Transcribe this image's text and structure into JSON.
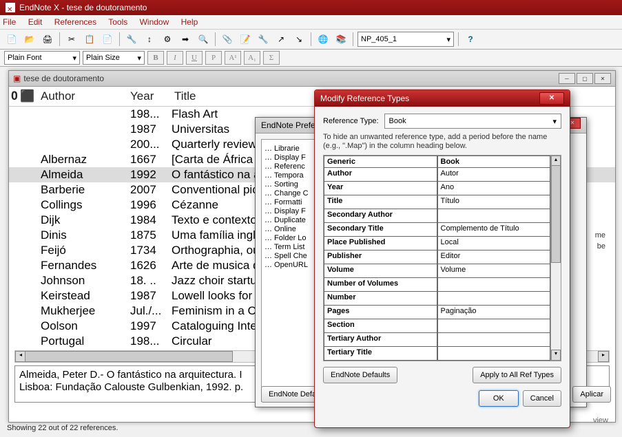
{
  "app_title": "EndNote X - tese de doutoramento",
  "menus": [
    "File",
    "Edit",
    "References",
    "Tools",
    "Window",
    "Help"
  ],
  "style_dropdown": "NP_405_1",
  "font_name": "Plain Font",
  "font_size": "Plain Size",
  "lib_title": "tese de doutoramento",
  "columns": {
    "author": "Author",
    "year": "Year",
    "title": "Title"
  },
  "rows": [
    {
      "author": "",
      "year": "198...",
      "title": "Flash Art"
    },
    {
      "author": "",
      "year": "1987",
      "title": "Universitas"
    },
    {
      "author": "",
      "year": "200...",
      "title": "Quarterly review of"
    },
    {
      "author": "Albernaz",
      "year": "1667",
      "title": "[Carta de África O"
    },
    {
      "author": "Almeida",
      "year": "1992",
      "title": "O fantástico na arq",
      "sel": true
    },
    {
      "author": "Barberie",
      "year": "2007",
      "title": "Conventional pictu"
    },
    {
      "author": "Collings",
      "year": "1996",
      "title": "Cézanne"
    },
    {
      "author": "Dijk",
      "year": "1984",
      "title": "Texto e contexto"
    },
    {
      "author": "Dinis",
      "year": "1875",
      "title": "Uma família inglez"
    },
    {
      "author": "Feijó",
      "year": "1734",
      "title": "Orthographia, ou a"
    },
    {
      "author": "Fernandes",
      "year": "1626",
      "title": "Arte de musica de"
    },
    {
      "author": "Johnson",
      "year": "18. ..",
      "title": "Jazz choir startup"
    },
    {
      "author": "Keirstead",
      "year": "1987",
      "title": "Lowell looks for an"
    },
    {
      "author": "Mukherjee",
      "year": "Jul./...",
      "title": "Feminism in a Cal"
    },
    {
      "author": "Oolson",
      "year": "1997",
      "title": "Cataloguing Intern"
    },
    {
      "author": "Portugal",
      "year": "198...",
      "title": "Circular"
    }
  ],
  "preview_line1": "Almeida, Peter D.- O fantástico na arquitectura.  I",
  "preview_line2": "Lisboa: Fundação Calouste Gulbenkian, 1992. p.",
  "status": "Showing 22 out of 22 references.",
  "pref_title": "EndNote Prefer",
  "pref_tree": [
    "Librarie",
    "Display F",
    "Referenc",
    "Tempora",
    "Sorting",
    "Change C",
    "Formatti",
    "Display F",
    "Duplicate",
    "Online",
    "Folder Lo",
    "Term List",
    "Spell Che",
    "OpenURL"
  ],
  "pref_defaults": "EndNote Defa",
  "pref_aplicar": "Aplicar",
  "modify_title": "Modify Reference Types",
  "rt_label": "Reference Type:",
  "rt_value": "Book",
  "hint": "To hide an unwanted reference type, add a period before the name (e.g., \".Map\") in the column heading below.",
  "map_header": {
    "left": "Generic",
    "right": "Book"
  },
  "map_rows": [
    {
      "g": "Author",
      "b": "Autor"
    },
    {
      "g": "Year",
      "b": "Ano"
    },
    {
      "g": "Title",
      "b": "Título"
    },
    {
      "g": "Secondary Author",
      "b": ""
    },
    {
      "g": "Secondary Title",
      "b": "Complemento de Título"
    },
    {
      "g": "Place Published",
      "b": "Local"
    },
    {
      "g": "Publisher",
      "b": "Editor"
    },
    {
      "g": "Volume",
      "b": "Volume"
    },
    {
      "g": "Number of Volumes",
      "b": ""
    },
    {
      "g": "Number",
      "b": ""
    },
    {
      "g": "Pages",
      "b": "Paginação"
    },
    {
      "g": "Section",
      "b": ""
    },
    {
      "g": "Tertiary Author",
      "b": ""
    },
    {
      "g": "Tertiary Title",
      "b": ""
    }
  ],
  "endnote_defaults": "EndNote Defaults",
  "apply_all": "Apply to All Ref Types",
  "ok": "OK",
  "cancel": "Cancel",
  "view_partial": "view",
  "me_partial": "me",
  "be_partial": "be"
}
